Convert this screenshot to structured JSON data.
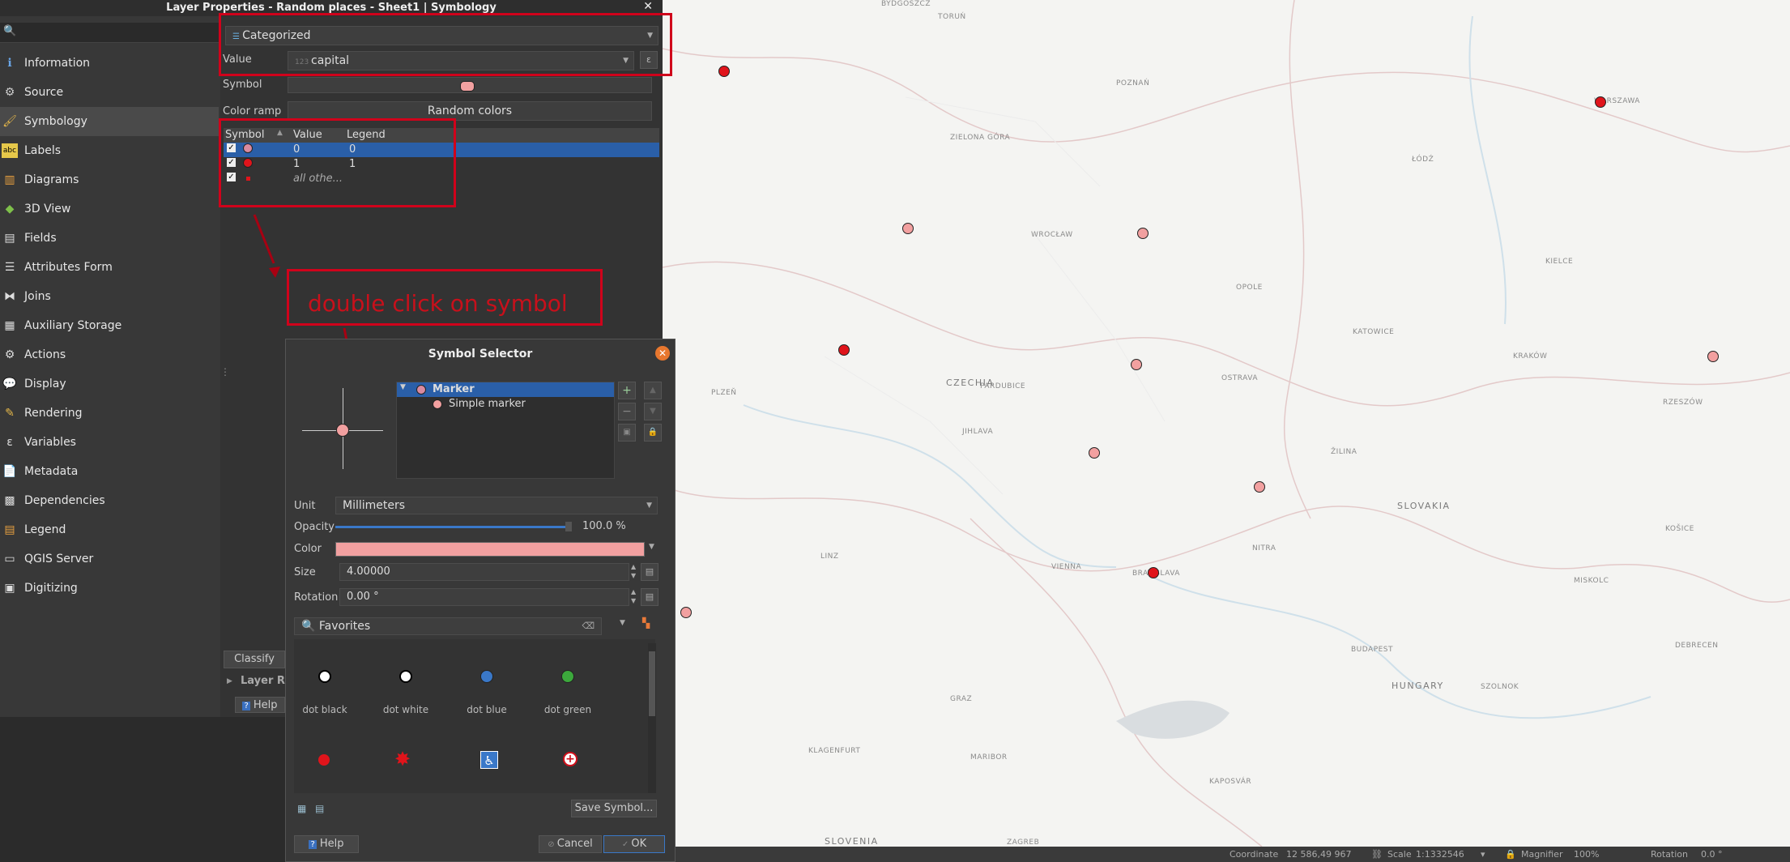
{
  "layer_props": {
    "title": "Layer Properties - Random places - Sheet1 | Symbology",
    "close": "✕",
    "search_placeholder": "",
    "sidebar": [
      {
        "label": "Information",
        "icon": "info-icon"
      },
      {
        "label": "Source",
        "icon": "source-icon"
      },
      {
        "label": "Symbology",
        "icon": "symbology-icon"
      },
      {
        "label": "Labels",
        "icon": "labels-icon"
      },
      {
        "label": "Diagrams",
        "icon": "diagrams-icon"
      },
      {
        "label": "3D View",
        "icon": "3d-view-icon"
      },
      {
        "label": "Fields",
        "icon": "fields-icon"
      },
      {
        "label": "Attributes Form",
        "icon": "attributes-form-icon"
      },
      {
        "label": "Joins",
        "icon": "joins-icon"
      },
      {
        "label": "Auxiliary Storage",
        "icon": "auxiliary-storage-icon"
      },
      {
        "label": "Actions",
        "icon": "actions-icon"
      },
      {
        "label": "Display",
        "icon": "display-icon"
      },
      {
        "label": "Rendering",
        "icon": "rendering-icon"
      },
      {
        "label": "Variables",
        "icon": "variables-icon"
      },
      {
        "label": "Metadata",
        "icon": "metadata-icon"
      },
      {
        "label": "Dependencies",
        "icon": "dependencies-icon"
      },
      {
        "label": "Legend",
        "icon": "legend-icon"
      },
      {
        "label": "QGIS Server",
        "icon": "qgis-server-icon"
      },
      {
        "label": "Digitizing",
        "icon": "digitizing-icon"
      }
    ],
    "renderer": "Categorized",
    "value_label": "Value",
    "value": "capital",
    "symbol_label": "Symbol",
    "color_ramp_label": "Color ramp",
    "color_ramp": "Random colors",
    "table": {
      "headers": [
        "Symbol",
        "Value",
        "Legend"
      ],
      "rows": [
        {
          "value": "0",
          "legend": "0",
          "color": "#d98aa0",
          "checked": "✓"
        },
        {
          "value": "1",
          "legend": "1",
          "color": "#e0141b",
          "checked": "✓"
        },
        {
          "value": "",
          "legend": "all othe...",
          "color": "#e0141b",
          "checked": "✓"
        }
      ]
    },
    "classify": "Classify",
    "layer_rendering": "Layer R",
    "help": "Help"
  },
  "annotation": {
    "text": "double click on symbol"
  },
  "symbol_selector": {
    "title": "Symbol Selector",
    "tree": {
      "root": "Marker",
      "child": "Simple marker"
    },
    "unit_label": "Unit",
    "unit": "Millimeters",
    "opacity_label": "Opacity",
    "opacity": "100.0 %",
    "color_label": "Color",
    "color": "#f2a0a0",
    "size_label": "Size",
    "size": "4.00000",
    "rotation_label": "Rotation",
    "rotation": "0.00 °",
    "search_placeholder": "Favorites",
    "favorites": [
      {
        "label": "dot  black",
        "color": "#000000"
      },
      {
        "label": "dot  white",
        "color": "#ffffff"
      },
      {
        "label": "dot blue",
        "color": "#3a78c8"
      },
      {
        "label": "dot green",
        "color": "#3ca83c"
      }
    ],
    "save_symbol": "Save Symbol...",
    "help": "Help",
    "cancel": "Cancel",
    "ok": "OK"
  },
  "map": {
    "labels": [
      {
        "t": "BYDGOSZCZ"
      },
      {
        "t": "TORUŃ"
      },
      {
        "t": "POZNAŃ"
      },
      {
        "t": "WARSZAWA"
      },
      {
        "t": "ŁÓDŹ"
      },
      {
        "t": "ZIELONA GÓRA"
      },
      {
        "t": "WROCŁAW"
      },
      {
        "t": "KATOWICE"
      },
      {
        "t": "KRAKÓW"
      },
      {
        "t": "CZECHIA"
      },
      {
        "t": "SLOVAKIA"
      },
      {
        "t": "HUNGARY"
      },
      {
        "t": "BUDAPEST"
      },
      {
        "t": "VIENNA"
      },
      {
        "t": "BRATISLAVA"
      },
      {
        "t": "OSTRAVA"
      },
      {
        "t": "PARDUBICE"
      },
      {
        "t": "JIHLAVA"
      },
      {
        "t": "LINZ"
      },
      {
        "t": "GRAZ"
      },
      {
        "t": "MARIBOR"
      },
      {
        "t": "KAPOSVÁR"
      },
      {
        "t": "SLOVENIA"
      },
      {
        "t": "ZAGREB"
      },
      {
        "t": "KOŠICE"
      },
      {
        "t": "MISKOLC"
      },
      {
        "t": "DEBRECEN"
      },
      {
        "t": "ŽILINA"
      },
      {
        "t": "NITRA"
      },
      {
        "t": "SZOLNOK"
      },
      {
        "t": "KLAGENFURT"
      },
      {
        "t": "PLZEŇ"
      },
      {
        "t": "KIELCE"
      },
      {
        "t": "RZESZÓW"
      },
      {
        "t": "OPOLE"
      }
    ]
  },
  "status": {
    "coordinate_label": "Coordinate",
    "coordinate": "12 586,49 967",
    "scale_label": "Scale",
    "scale": "1:1332546",
    "magnifier_label": "Magnifier",
    "magnifier": "100%",
    "rotation_label": "Rotation",
    "rotation": "0.0 °"
  }
}
